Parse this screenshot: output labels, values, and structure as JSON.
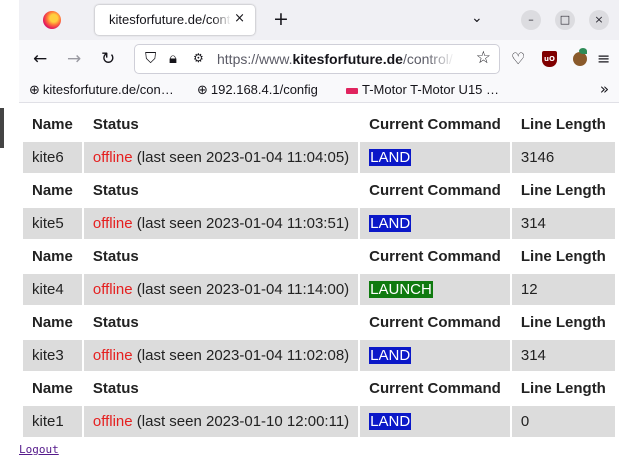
{
  "tab": {
    "title": "kitesforfuture.de/control/co",
    "close_glyph": "×",
    "new_tab_glyph": "+"
  },
  "window": {
    "list_tabs_glyph": "⌄",
    "minimize_glyph": "–",
    "maximize_glyph": "□",
    "close_glyph": "×"
  },
  "nav": {
    "back_glyph": "←",
    "forward_glyph": "→",
    "reload_glyph": "↻",
    "url_prefix": "https://www.",
    "url_domain": "kitesforfuture.de",
    "url_suffix": "/control/",
    "star_glyph": "☆",
    "pocket_glyph": "♡",
    "ublock_label": "uO",
    "menu_glyph": "≡"
  },
  "bookmarks": [
    {
      "label": "kitesforfuture.de/con…",
      "icon": "globe-icon"
    },
    {
      "label": "192.168.4.1/config",
      "icon": "globe-icon"
    },
    {
      "label": "T-Motor T-Motor U15 …",
      "icon": "tmotor-icon"
    }
  ],
  "bookmarks_more": "»",
  "table": {
    "headers": {
      "name": "Name",
      "status": "Status",
      "command": "Current Command",
      "length": "Line Length"
    },
    "kites": [
      {
        "name": "kite6",
        "state": "offline",
        "last_seen": " (last seen 2023-01-04 11:04:05)",
        "command": "LAND",
        "length": "3146"
      },
      {
        "name": "kite5",
        "state": "offline",
        "last_seen": " (last seen 2023-01-04 11:03:51)",
        "command": "LAND",
        "length": "314"
      },
      {
        "name": "kite4",
        "state": "offline",
        "last_seen": " (last seen 2023-01-04 11:14:00)",
        "command": "LAUNCH",
        "length": "12"
      },
      {
        "name": "kite3",
        "state": "offline",
        "last_seen": " (last seen 2023-01-04 11:02:08)",
        "command": "LAND",
        "length": "314"
      },
      {
        "name": "kite1",
        "state": "offline",
        "last_seen": " (last seen 2023-01-10 12:00:11)",
        "command": "LAND",
        "length": "0"
      }
    ]
  },
  "logout_label": "Logout",
  "colors": {
    "offline": "#e52020",
    "land_bg": "#0b18c8",
    "launch_bg": "#0f7a0f",
    "row_bg": "#dcdcdc"
  }
}
